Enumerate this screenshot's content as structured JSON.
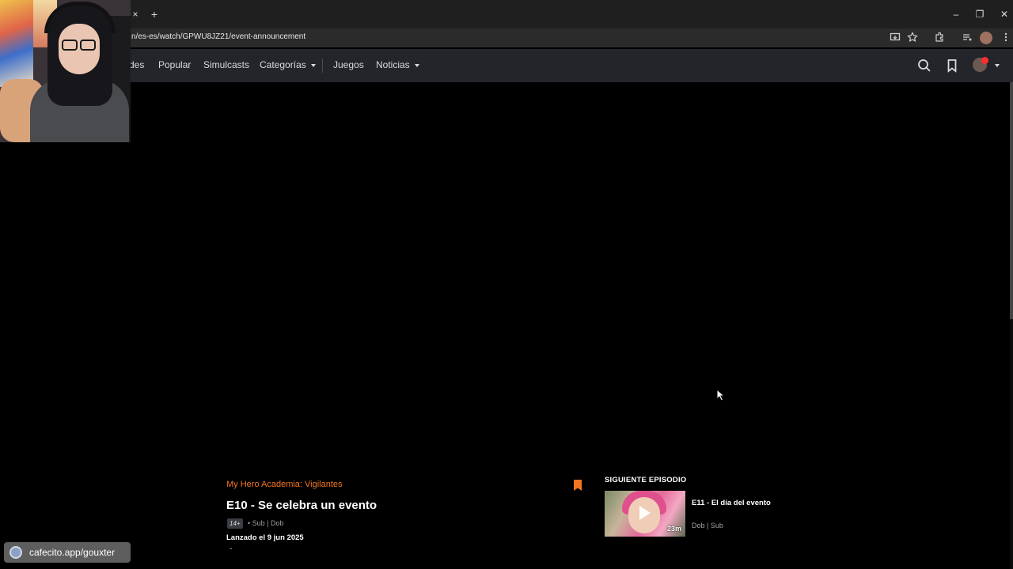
{
  "browser": {
    "url": "n/es-es/watch/GPWU8JZ21/event-announcement",
    "tab_close": "×",
    "tab_new": "+",
    "window_controls": {
      "minimize": "–",
      "restore": "❐",
      "close": "✕"
    }
  },
  "site_nav": {
    "items": [
      {
        "label": "des"
      },
      {
        "label": "Popular"
      },
      {
        "label": "Simulcasts"
      },
      {
        "label": "Categorías"
      },
      {
        "label": "Juegos"
      },
      {
        "label": "Noticias"
      }
    ],
    "accent_color": "#f47521"
  },
  "episode": {
    "series": "My Hero Academia: Vigilantes",
    "title": "E10 - Se celebra un evento",
    "rating": "14+",
    "audio": "• Sub | Dob",
    "release": "Lanzado el 9 jun 2025",
    "dash": "-"
  },
  "next_episode": {
    "heading": "SIGUIENTE EPISODIO",
    "title": "E11 - El día del evento",
    "duration": "23m",
    "audio": "Dob | Sub"
  },
  "overlay": {
    "donate_text": "cafecito.app/gouxter"
  }
}
